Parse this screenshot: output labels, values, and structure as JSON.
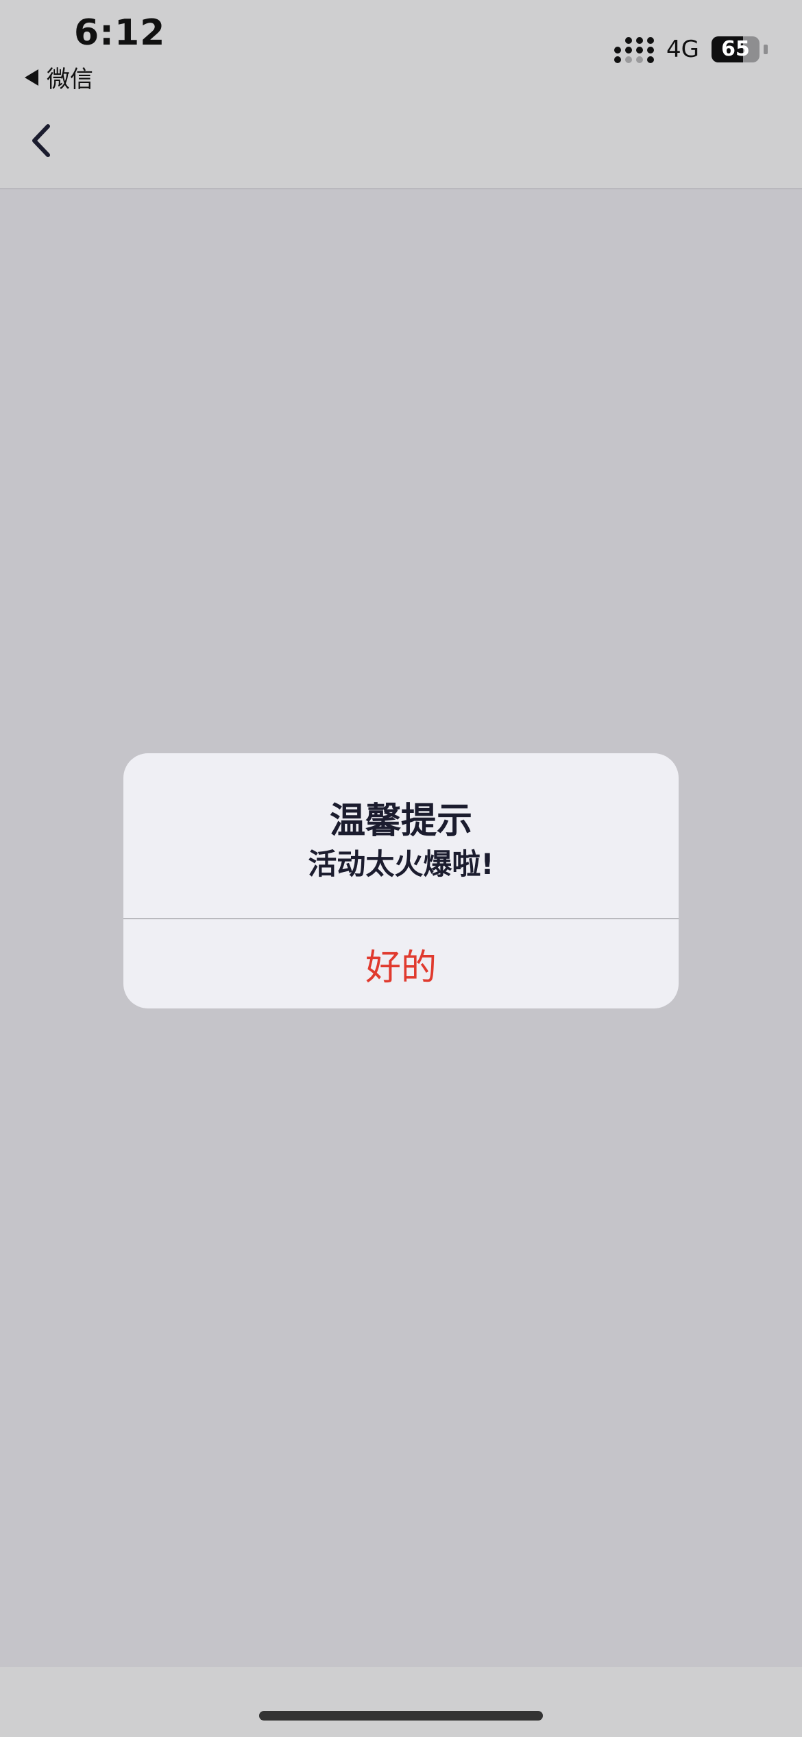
{
  "status_bar": {
    "time": "6:12",
    "back_app_label": "微信",
    "network": "4G",
    "battery_level": 65
  },
  "nav": {
    "back_icon": "chevron-left-icon"
  },
  "alert": {
    "title": "温馨提示",
    "message": "活动太火爆啦!",
    "ok_label": "好的",
    "ok_color": "#e03a2e"
  },
  "colors": {
    "background": "#c5c4c9",
    "top_bar": "#cfcfd0",
    "alert_bg": "#efeff4"
  }
}
